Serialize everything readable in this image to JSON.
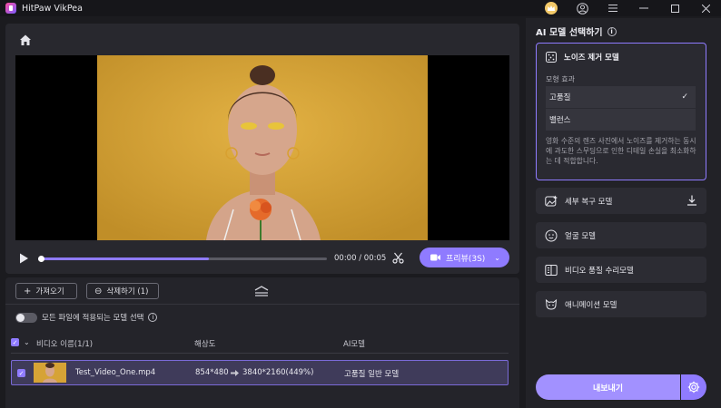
{
  "window": {
    "title": "HitPaw VikPea"
  },
  "player": {
    "current_time": "00:00",
    "duration": "00:05",
    "time_separator": " / ",
    "progress": 0.0,
    "preview_label": "프리뷰(3S)"
  },
  "list_toolbar": {
    "import_label": "가져오기",
    "delete_label": "삭제하기 (1)"
  },
  "apply_all": {
    "label": "모든 파일에 적용되는 모델 선택",
    "enabled": false
  },
  "table": {
    "columns": {
      "name": "비디오 이름(1/1)",
      "resolution": "해상도",
      "ai_model": "AI모델"
    },
    "rows": [
      {
        "name": "Test_Video_One.mp4",
        "resolution_from": "854*480",
        "resolution_to": "3840*2160(449%)",
        "model": "고품질 일반 모델",
        "checked": true
      }
    ]
  },
  "side": {
    "title": "AI 모델 선택하기",
    "active_model": {
      "name": "노이즈 제거 모델",
      "sub_label": "모형 효과",
      "options": [
        {
          "label": "고품질",
          "selected": true
        },
        {
          "label": "밸런스",
          "selected": false
        }
      ],
      "description": "영화 수준의 렌즈 사진에서 노이즈를 제거하는 동시에 과도한 스무딩으로 인한 디테일 손실을 최소화하는 데 적합합니다."
    },
    "models": [
      {
        "label": "세부 복구 모델",
        "icon": "detail-restore-icon"
      },
      {
        "label": "얼굴 모델",
        "icon": "face-icon"
      },
      {
        "label": "비디오 품질 수리모델",
        "icon": "video-repair-icon"
      },
      {
        "label": "애니메이션 모델",
        "icon": "animation-icon"
      }
    ],
    "export_label": "내보내기"
  },
  "colors": {
    "accent": "#8f7bff",
    "background": "#1b1b1f",
    "panel": "#28282e"
  }
}
